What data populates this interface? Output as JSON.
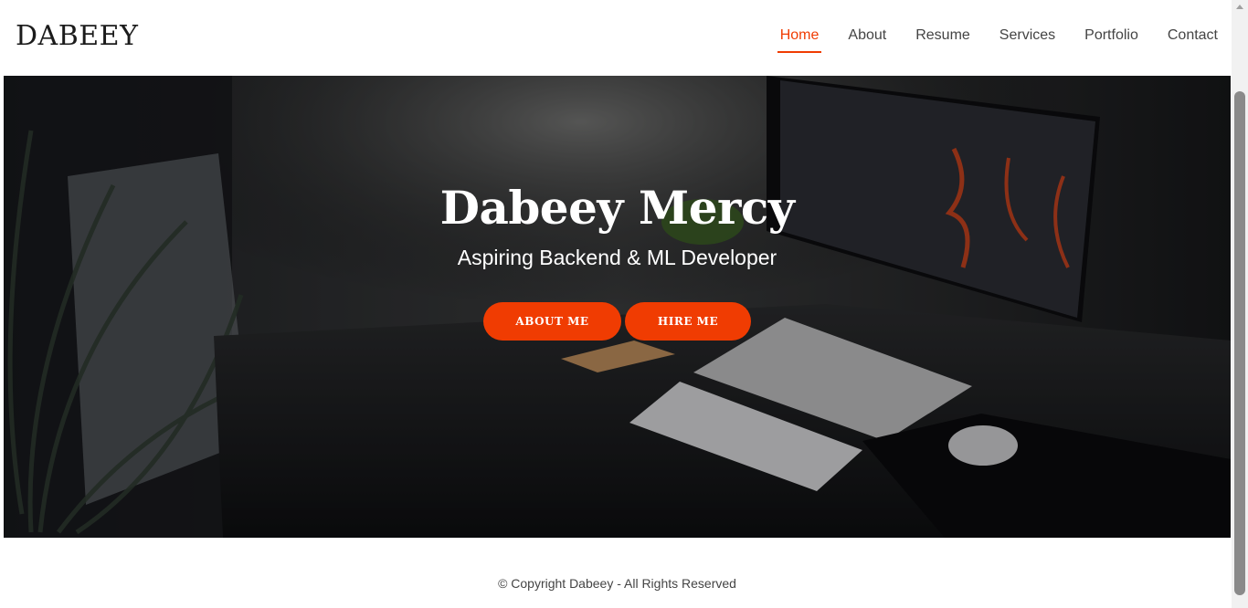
{
  "brand": {
    "logo": "DABEEY",
    "accent": "#f03c02"
  },
  "nav": {
    "items": [
      {
        "label": "Home",
        "active": true
      },
      {
        "label": "About"
      },
      {
        "label": "Resume"
      },
      {
        "label": "Services"
      },
      {
        "label": "Portfolio"
      },
      {
        "label": "Contact"
      }
    ]
  },
  "hero": {
    "title": "Dabeey Mercy",
    "subtitle": "Aspiring Backend & ML Developer",
    "buttons": {
      "about": "ABOUT ME",
      "hire": "HIRE ME"
    },
    "background": "dark desk setup photo"
  },
  "footer": {
    "copyright": "© Copyright Dabeey - All Rights Reserved"
  }
}
